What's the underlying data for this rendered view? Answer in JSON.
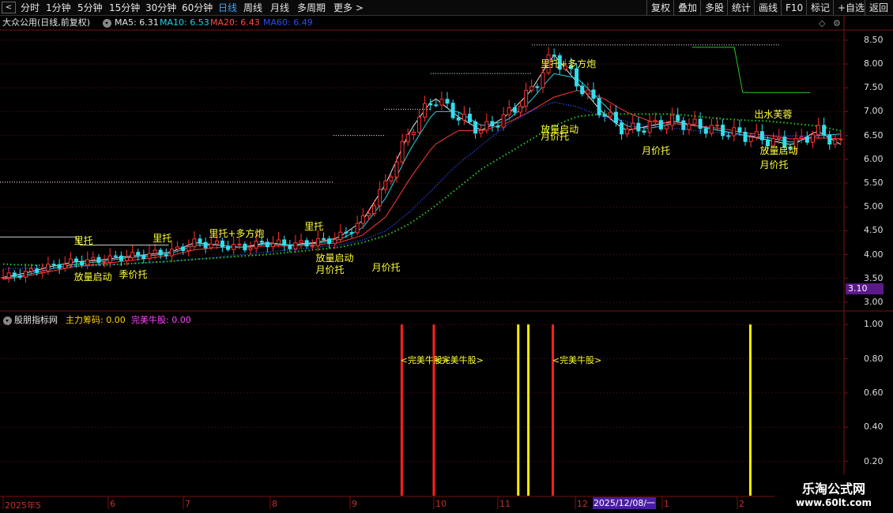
{
  "toolbar": {
    "back_glyph": "<",
    "periods": [
      "分时",
      "1分钟",
      "5分钟",
      "15分钟",
      "30分钟",
      "60分钟",
      "日线",
      "周线",
      "月线",
      "多周期",
      "更多 >"
    ],
    "active_period": "日线",
    "actions": [
      "复权",
      "叠加",
      "多股",
      "统计",
      "画线",
      "F10",
      "标记",
      "+自选",
      "返回"
    ]
  },
  "header": {
    "stock_title": "大众公用(日线,前复权)",
    "ma": [
      {
        "label": "MA5: 6.31",
        "color": "#e6e6e6"
      },
      {
        "label": "MA10: 6.53",
        "color": "#26d0e6"
      },
      {
        "label": "MA20: 6.43",
        "color": "#ff4a4a"
      },
      {
        "label": "MA60: 6.49",
        "color": "#2a4aff"
      }
    ],
    "icons": [
      "diamond-icon",
      "settings-icon"
    ]
  },
  "indicator": {
    "title": "股朋指标网",
    "items": [
      {
        "label": "主力筹码: 0.00",
        "color": "#ffd700"
      },
      {
        "label": "完美牛股: 0.00",
        "color": "#ff44ff"
      }
    ]
  },
  "current_price_badge": "3.10",
  "date_badge": "2025/12/08/一",
  "watermark": {
    "title": "乐淘公式网",
    "url": "www.60lt.com"
  },
  "colors": {
    "up": "#ff3333",
    "down": "#33ddee",
    "ma5": "#e6e6e6",
    "ma10": "#26d0e6",
    "ma20": "#ff3a3a",
    "ma60": "#3050ff",
    "ma120": "#22cc22",
    "annotation": "#ffff33",
    "grid": "#6a1010"
  },
  "chart_data": [
    {
      "type": "candlestick",
      "y_ticks": [
        3.0,
        3.5,
        4.0,
        4.5,
        5.0,
        5.5,
        6.0,
        6.5,
        7.0,
        7.5,
        8.0,
        8.5
      ],
      "ylim": [
        2.85,
        8.68
      ],
      "x_ticks": [
        "2025年5",
        "6",
        "7",
        "8",
        "9",
        "10",
        "11",
        "12",
        "1",
        "2"
      ],
      "grid": true,
      "series": [
        {
          "name": "MA5",
          "values": [
            3.52,
            3.62,
            3.75,
            3.85,
            3.88,
            3.95,
            4.0,
            4.05,
            4.25,
            4.2,
            4.15,
            4.25,
            4.2,
            4.25,
            4.35,
            4.7,
            5.5,
            6.6,
            7.3,
            6.9,
            6.6,
            6.9,
            7.4,
            8.2,
            7.6,
            7.0,
            6.6,
            6.7,
            6.8,
            6.7,
            6.6,
            6.5,
            6.4,
            6.3,
            6.6,
            6.31
          ]
        },
        {
          "name": "MA10",
          "values": [
            3.5,
            3.58,
            3.7,
            3.8,
            3.85,
            3.92,
            3.97,
            4.02,
            4.2,
            4.2,
            4.15,
            4.22,
            4.2,
            4.23,
            4.3,
            4.55,
            5.2,
            6.2,
            7.0,
            7.0,
            6.7,
            6.8,
            7.2,
            7.8,
            7.7,
            7.2,
            6.7,
            6.65,
            6.75,
            6.7,
            6.6,
            6.5,
            6.45,
            6.35,
            6.5,
            6.53
          ]
        },
        {
          "name": "MA20",
          "values": [
            3.48,
            3.55,
            3.65,
            3.75,
            3.8,
            3.86,
            3.92,
            3.98,
            4.1,
            4.15,
            4.15,
            4.18,
            4.18,
            4.2,
            4.25,
            4.4,
            4.8,
            5.6,
            6.3,
            6.6,
            6.6,
            6.75,
            7.0,
            7.3,
            7.45,
            7.3,
            7.0,
            6.8,
            6.75,
            6.7,
            6.65,
            6.55,
            6.5,
            6.42,
            6.45,
            6.43
          ]
        },
        {
          "name": "MA60",
          "values": [
            3.7,
            3.72,
            3.73,
            3.75,
            3.77,
            3.8,
            3.83,
            3.86,
            3.9,
            3.95,
            4.0,
            4.05,
            4.1,
            4.15,
            4.2,
            4.3,
            4.5,
            4.9,
            5.4,
            5.9,
            6.3,
            6.7,
            7.0,
            7.2,
            7.1,
            6.9,
            6.8,
            6.7,
            6.65,
            6.6,
            6.55,
            6.5,
            6.5,
            6.49,
            6.49,
            6.49
          ]
        },
        {
          "name": "MA120",
          "values": [
            3.8,
            3.78,
            3.77,
            3.77,
            3.78,
            3.8,
            3.83,
            3.86,
            3.9,
            3.93,
            3.97,
            4.0,
            4.05,
            4.1,
            4.15,
            4.25,
            4.4,
            4.65,
            5.0,
            5.4,
            5.8,
            6.1,
            6.4,
            6.7,
            6.9,
            6.95,
            6.95,
            6.95,
            6.95,
            6.9,
            6.85,
            6.82,
            6.8,
            6.75,
            6.7,
            6.6
          ]
        }
      ],
      "annotations": [
        {
          "text": "里托",
          "x": 14,
          "y": 4.3
        },
        {
          "text": "放量启动",
          "x": 14,
          "y": 3.55
        },
        {
          "text": "季价托",
          "x": 22,
          "y": 3.6
        },
        {
          "text": "里托",
          "x": 28,
          "y": 4.35
        },
        {
          "text": "里托+多方炮",
          "x": 38,
          "y": 4.45
        },
        {
          "text": "里托",
          "x": 55,
          "y": 4.6
        },
        {
          "text": "放量启动",
          "x": 57,
          "y": 3.95
        },
        {
          "text": "月价托",
          "x": 57,
          "y": 3.7
        },
        {
          "text": "月价托",
          "x": 67,
          "y": 3.75
        },
        {
          "text": "里托+多方炮",
          "x": 97,
          "y": 8.02
        },
        {
          "text": "放量启动",
          "x": 97,
          "y": 6.65
        },
        {
          "text": "月价托",
          "x": 97,
          "y": 6.5
        },
        {
          "text": "月价托",
          "x": 115,
          "y": 6.2
        },
        {
          "text": "出水芙蓉",
          "x": 135,
          "y": 6.95
        },
        {
          "text": "放量启动",
          "x": 136,
          "y": 6.2
        },
        {
          "text": "月价托",
          "x": 136,
          "y": 5.9
        }
      ]
    },
    {
      "type": "bar",
      "name": "股朋指标网",
      "y_ticks": [
        0.2,
        0.4,
        0.6,
        0.8,
        1.0
      ],
      "ylim": [
        0,
        1.07
      ],
      "signals": [
        {
          "x": 0.476,
          "value": 1.0,
          "color": "#ff2020"
        },
        {
          "x": 0.514,
          "value": 1.0,
          "color": "#ff2020"
        },
        {
          "x": 0.614,
          "value": 1.0,
          "color": "#ffee00"
        },
        {
          "x": 0.626,
          "value": 1.0,
          "color": "#ffee00"
        },
        {
          "x": 0.655,
          "value": 1.0,
          "color": "#ff2020"
        },
        {
          "x": 0.889,
          "value": 1.0,
          "color": "#ffee00"
        }
      ],
      "labels": [
        {
          "text": "<完美牛股>",
          "x": 0.48
        },
        {
          "text": "<完美牛股>",
          "x": 0.52
        },
        {
          "text": "<完美牛股>",
          "x": 0.66
        }
      ]
    }
  ]
}
